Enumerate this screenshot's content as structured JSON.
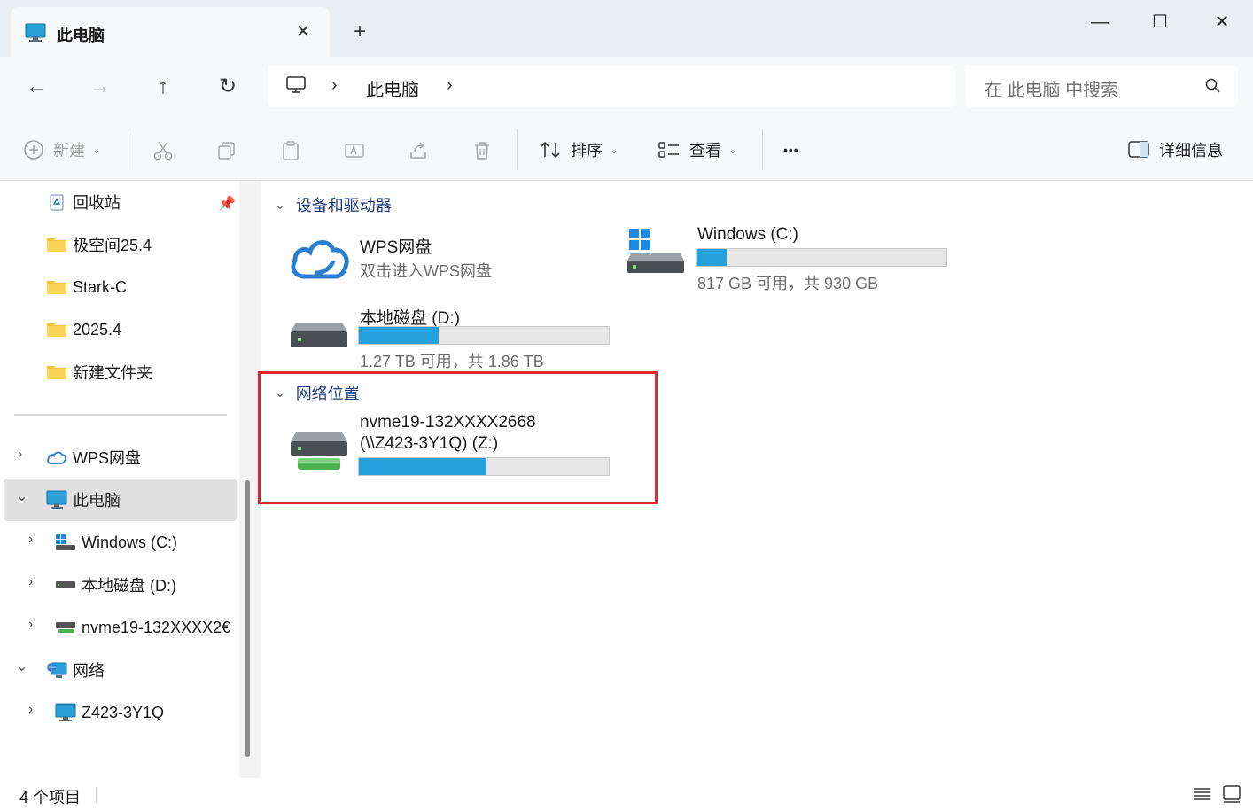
{
  "tab": {
    "title": "此电脑",
    "close": "✕",
    "new_tab": "+"
  },
  "window_controls": {
    "minimize": "—",
    "maximize": "☐",
    "close": "✕"
  },
  "nav": {
    "back": "←",
    "forward": "→",
    "up": "↑",
    "refresh": "↻"
  },
  "address": {
    "chevron1": "›",
    "location": "此电脑",
    "chevron2": "›"
  },
  "search": {
    "placeholder": "在 此电脑 中搜索"
  },
  "toolbar": {
    "new_label": "新建",
    "sort_label": "排序",
    "view_label": "查看",
    "more_label": "•••",
    "details_label": "详细信息"
  },
  "sidebar": {
    "quick": [
      {
        "label": "回收站",
        "icon": "recycle-bin-icon"
      },
      {
        "label": "极空间25.4",
        "icon": "folder-icon"
      },
      {
        "label": "Stark-C",
        "icon": "folder-icon"
      },
      {
        "label": "2025.4",
        "icon": "folder-icon"
      },
      {
        "label": "新建文件夹",
        "icon": "folder-icon"
      }
    ],
    "tree": [
      {
        "label": "WPS网盘",
        "icon": "cloud-icon",
        "chevron": "›"
      },
      {
        "label": "此电脑",
        "icon": "computer-icon",
        "chevron": "⌄",
        "selected": true
      },
      {
        "label": "Windows (C:)",
        "icon": "windows-drive-icon",
        "chevron": "›"
      },
      {
        "label": "本地磁盘 (D:)",
        "icon": "drive-icon",
        "chevron": "›"
      },
      {
        "label": "nvme19-132XXXX2€",
        "icon": "network-drive-icon",
        "chevron": "›"
      },
      {
        "label": "网络",
        "icon": "network-icon",
        "chevron": "⌄"
      },
      {
        "label": "Z423-3Y1Q",
        "icon": "computer-icon",
        "chevron": "›"
      }
    ]
  },
  "groups": {
    "devices": {
      "label": "设备和驱动器",
      "chevron": "⌄"
    },
    "network": {
      "label": "网络位置",
      "chevron": "⌄"
    }
  },
  "tiles": {
    "wps": {
      "name": "WPS网盘",
      "sub": "双击进入WPS网盘"
    },
    "c": {
      "name": "Windows (C:)",
      "sub": "817 GB 可用，共 930 GB",
      "used_fraction": 0.12
    },
    "d": {
      "name": "本地磁盘 (D:)",
      "sub": "1.27 TB 可用，共 1.86 TB",
      "used_fraction": 0.32
    },
    "z": {
      "name_line1": "nvme19-132XXXX2668",
      "name_line2": "(\\\\Z423-3Y1Q) (Z:)",
      "used_fraction": 0.51
    }
  },
  "status": {
    "count": "4 个项目"
  },
  "colors": {
    "accent": "#26a0da",
    "highlight": "#e0262e",
    "group_header": "#1f3d7a"
  }
}
